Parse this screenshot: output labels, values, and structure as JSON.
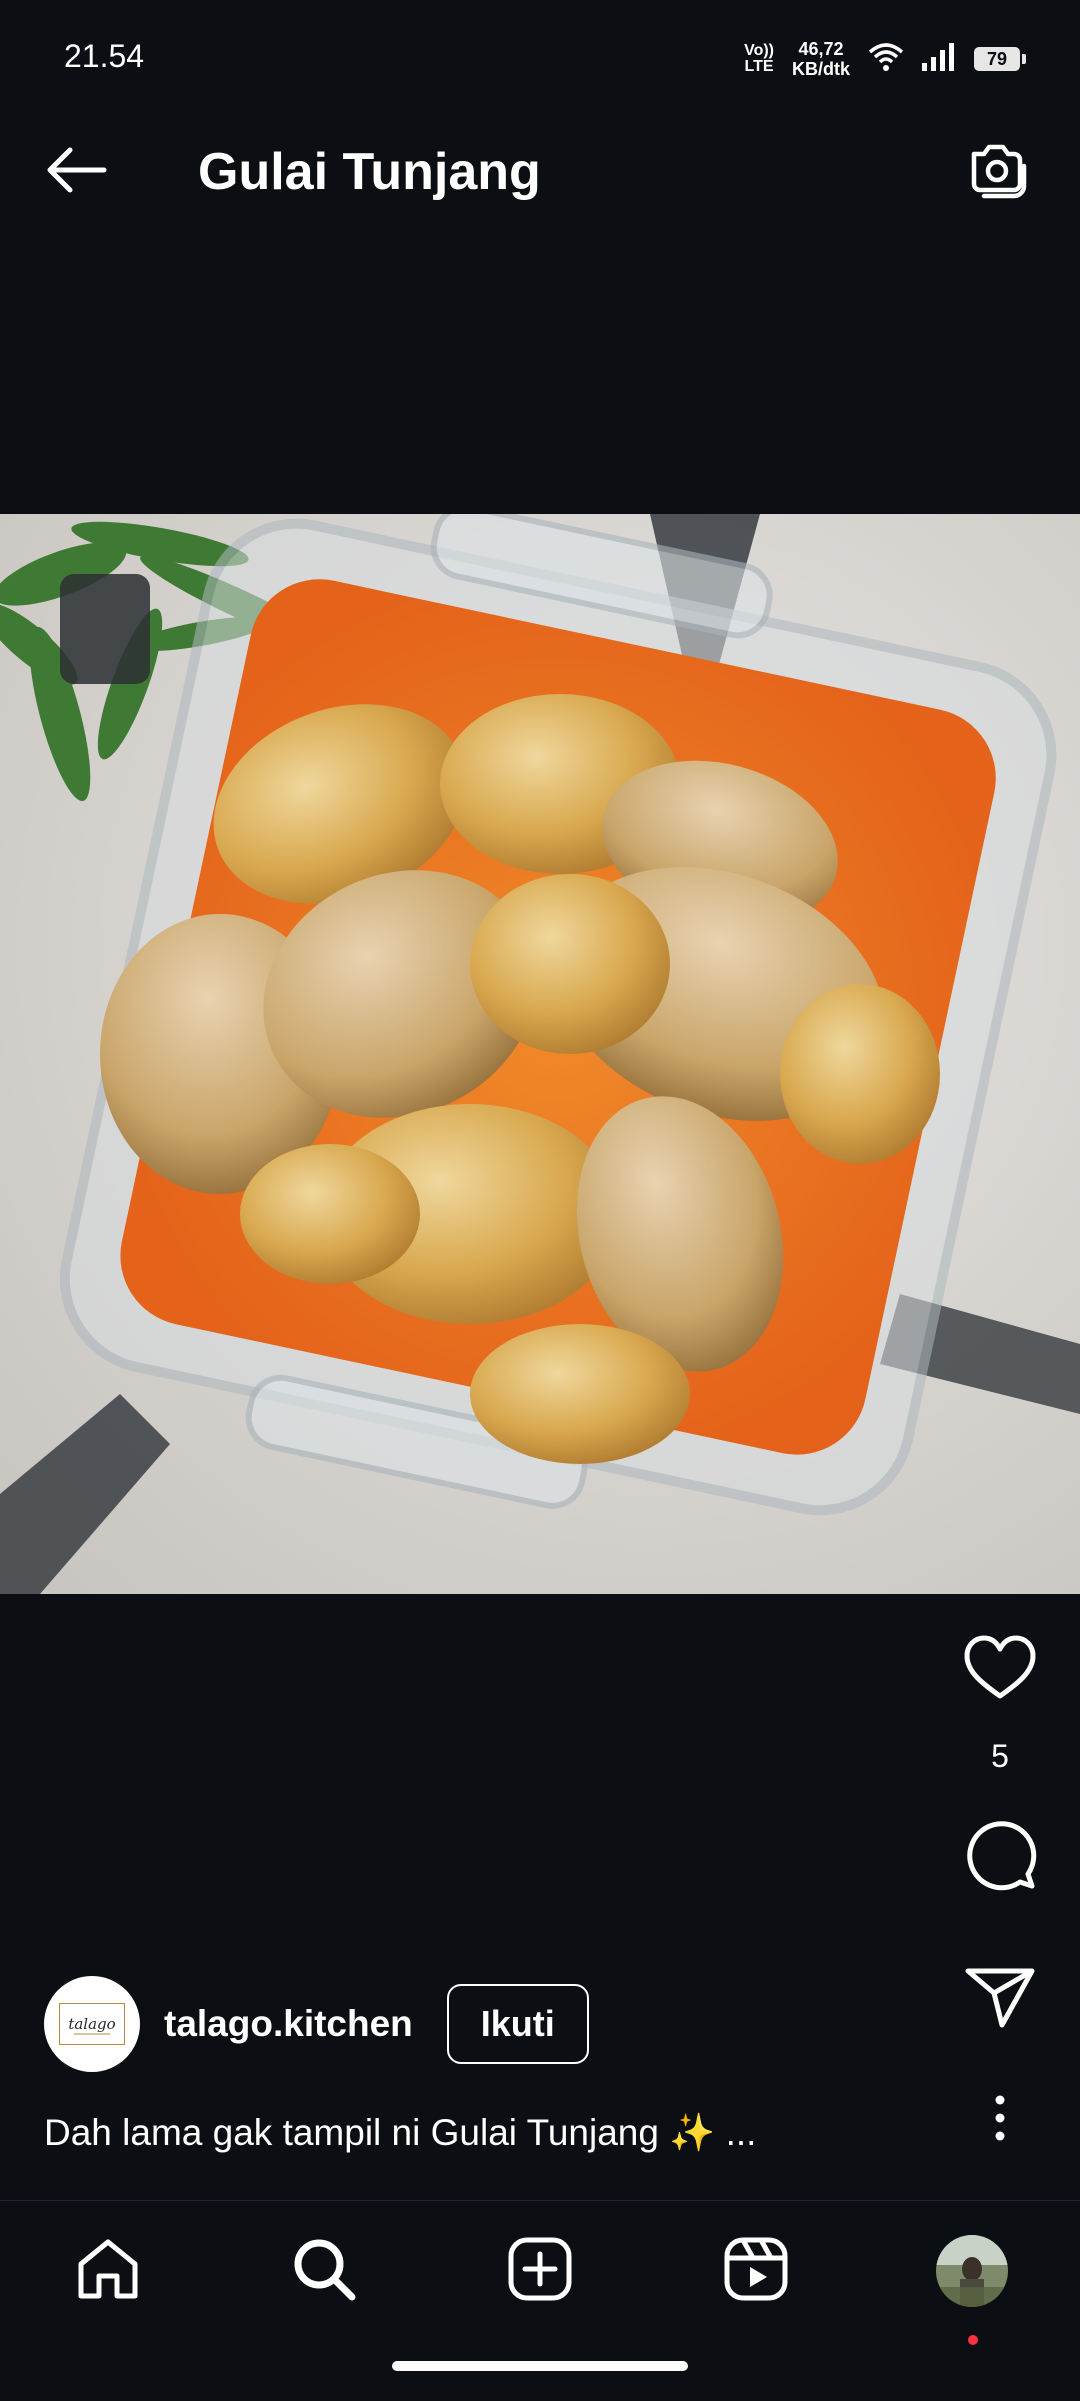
{
  "status_bar": {
    "time": "21.54",
    "volte_top": "Vo))",
    "volte_bottom": "LTE",
    "net_speed_value": "46,72",
    "net_speed_unit": "KB/dtk",
    "battery_level": "79"
  },
  "header": {
    "title": "Gulai Tunjang"
  },
  "post": {
    "like_count": "5",
    "author": {
      "username": "talago.kitchen",
      "avatar_text": "talago",
      "follow_label": "Ikuti"
    },
    "caption": "Dah lama gak tampil ni Gulai Tunjang ✨ ..."
  },
  "icons": {
    "back": "arrow-left-icon",
    "camera": "camera-icon",
    "like": "heart-icon",
    "comment": "comment-bubble-icon",
    "share": "paper-plane-icon",
    "more": "more-vertical-icon",
    "nav_home": "home-icon",
    "nav_search": "search-icon",
    "nav_create": "plus-square-icon",
    "nav_reels": "reels-icon"
  },
  "colors": {
    "background": "#0b0e13",
    "text": "#ffffff",
    "notification_dot": "#ff3040",
    "curry_orange": "#e8741c"
  }
}
